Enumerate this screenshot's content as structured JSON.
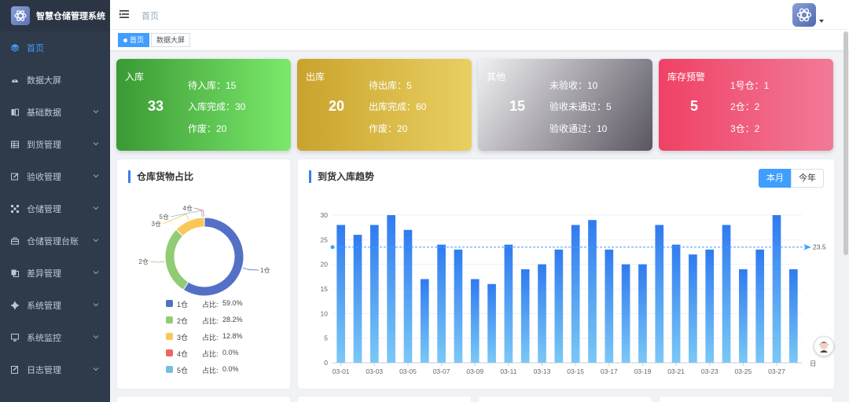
{
  "app": {
    "title": "智慧仓储管理系统"
  },
  "sidebar": {
    "items": [
      {
        "label": "首页",
        "icon": "cube-icon",
        "active": true,
        "has_children": false
      },
      {
        "label": "数据大屏",
        "icon": "dashboard-icon",
        "active": false,
        "has_children": false
      },
      {
        "label": "基础数据",
        "icon": "book-icon",
        "active": false,
        "has_children": true
      },
      {
        "label": "到货管理",
        "icon": "table-icon",
        "active": false,
        "has_children": true
      },
      {
        "label": "验收管理",
        "icon": "edit-icon",
        "active": false,
        "has_children": true
      },
      {
        "label": "仓储管理",
        "icon": "grid-icon",
        "active": false,
        "has_children": true
      },
      {
        "label": "仓储管理台账",
        "icon": "briefcase-icon",
        "active": false,
        "has_children": true
      },
      {
        "label": "差异管理",
        "icon": "copy-icon",
        "active": false,
        "has_children": true
      },
      {
        "label": "系统管理",
        "icon": "gear-icon",
        "active": false,
        "has_children": true
      },
      {
        "label": "系统监控",
        "icon": "monitor-icon",
        "active": false,
        "has_children": true
      },
      {
        "label": "日志管理",
        "icon": "log-icon",
        "active": false,
        "has_children": true
      }
    ]
  },
  "header": {
    "breadcrumb": "首页"
  },
  "tags": [
    {
      "label": "首页",
      "active": true
    },
    {
      "label": "数据大屏",
      "active": false
    }
  ],
  "cards": [
    {
      "title": "入库",
      "count": "33",
      "lines": [
        "待入库：15",
        "入库完成：30",
        "作废：20"
      ],
      "gradient": [
        "#3a9a34",
        "#7ce96c"
      ]
    },
    {
      "title": "出库",
      "count": "20",
      "lines": [
        "待出库：5",
        "出库完成：60",
        "作废：20"
      ],
      "gradient": [
        "#c9a32c",
        "#e9cf62"
      ]
    },
    {
      "title": "其他",
      "count": "15",
      "lines": [
        "未验收：10",
        "验收未通过：5",
        "验收通过：10"
      ],
      "gradient": [
        "#f1f1f4",
        "#5a5560"
      ]
    },
    {
      "title": "库存预警",
      "count": "5",
      "lines": [
        "1号仓：1",
        "2仓：2",
        "3仓：2"
      ],
      "gradient": [
        "#ef4165",
        "#f27a97"
      ]
    }
  ],
  "pie_panel": {
    "title": "仓库货物占比",
    "ratio_label": "占比:"
  },
  "bar_panel": {
    "title": "到货入库趋势",
    "toggle_month": "本月",
    "toggle_year": "今年"
  },
  "chart_data": [
    {
      "type": "pie",
      "categories": [
        "1仓",
        "2仓",
        "3仓",
        "4仓",
        "5仓"
      ],
      "values": [
        59.0,
        28.2,
        12.8,
        0.0,
        0.0
      ],
      "percent_labels": [
        "59.0%",
        "28.2%",
        "12.8%",
        "0.0%",
        "0.0%"
      ],
      "colors": [
        "#5470c6",
        "#91cc75",
        "#fac858",
        "#ee6666",
        "#73c0de"
      ],
      "donut": true,
      "legend_placement": "bottom"
    },
    {
      "type": "bar",
      "categories": [
        "03-01",
        "03-02",
        "03-03",
        "03-04",
        "03-05",
        "03-06",
        "03-07",
        "03-08",
        "03-09",
        "03-10",
        "03-11",
        "03-12",
        "03-13",
        "03-14",
        "03-15",
        "03-16",
        "03-17",
        "03-18",
        "03-19",
        "03-20",
        "03-21",
        "03-22",
        "03-23",
        "03-24",
        "03-25",
        "03-26",
        "03-27",
        "03-28"
      ],
      "tick_labels": [
        "03-01",
        "03-03",
        "03-05",
        "03-07",
        "03-09",
        "03-11",
        "03-13",
        "03-15",
        "03-17",
        "03-19",
        "03-21",
        "03-23",
        "03-25",
        "03-27"
      ],
      "values": [
        28,
        26,
        28,
        30,
        27,
        17,
        24,
        23,
        17,
        16,
        24,
        19,
        20,
        23,
        28,
        29,
        23,
        20,
        20,
        28,
        24,
        22,
        23,
        28,
        19,
        23,
        30,
        19
      ],
      "ylim": [
        0,
        30
      ],
      "yticks": [
        0,
        5,
        10,
        15,
        20,
        25,
        30
      ],
      "x_unit_label": "日",
      "average": 23.5,
      "average_label": "23.5",
      "bar_colors": [
        "#2f7bf0",
        "#7bc8f6"
      ],
      "grid": true
    }
  ]
}
